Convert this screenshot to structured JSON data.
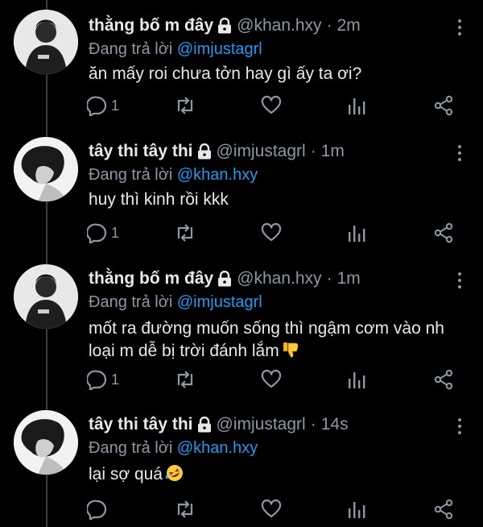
{
  "tweets": [
    {
      "name": "thằng bố m đây",
      "handle": "@khan.hxy",
      "time": "2m",
      "reply_label": "Đang trả lời",
      "reply_to": "@imjustagrl",
      "lines": [
        "ăn mấy roi chưa tởn hay gì ấy ta ơi?"
      ],
      "reply_count": "1",
      "avatar": "avatar-khan"
    },
    {
      "name": "tây thi tây thi",
      "handle": "@imjustagrl",
      "time": "1m",
      "reply_label": "Đang trả lời",
      "reply_to": "@khan.hxy",
      "lines": [
        "huy thì kinh rồi kkk"
      ],
      "reply_count": "1",
      "avatar": "avatar-imjustagrl"
    },
    {
      "name": "thằng bố m đây",
      "handle": "@khan.hxy",
      "time": "1m",
      "reply_label": "Đang trả lời",
      "reply_to": "@imjustagrl",
      "lines": [
        "mốt ra đường muốn sống thì ngậm cơm vào nh",
        "loại m dễ bị trời đánh lắm"
      ],
      "reply_count": "1",
      "avatar": "avatar-khan",
      "emoji": "thumbs-down"
    },
    {
      "name": "tây thi tây thi",
      "handle": "@imjustagrl",
      "time": "14s",
      "reply_label": "Đang trả lời",
      "reply_to": "@khan.hxy",
      "lines": [
        "lại sợ quá"
      ],
      "reply_count": "",
      "avatar": "avatar-imjustagrl",
      "emoji": "rofl"
    }
  ],
  "icons": {
    "reply": "reply-icon",
    "retweet": "retweet-icon",
    "like": "heart-icon",
    "analytics": "analytics-icon",
    "share": "share-icon",
    "lock": "lock-icon",
    "more": "more-icon"
  },
  "colors": {
    "background": "#000000",
    "text": "#e7e9ea",
    "muted": "#8b98a5",
    "link": "#1d9bf0",
    "thread_line": "#3a3e42"
  }
}
